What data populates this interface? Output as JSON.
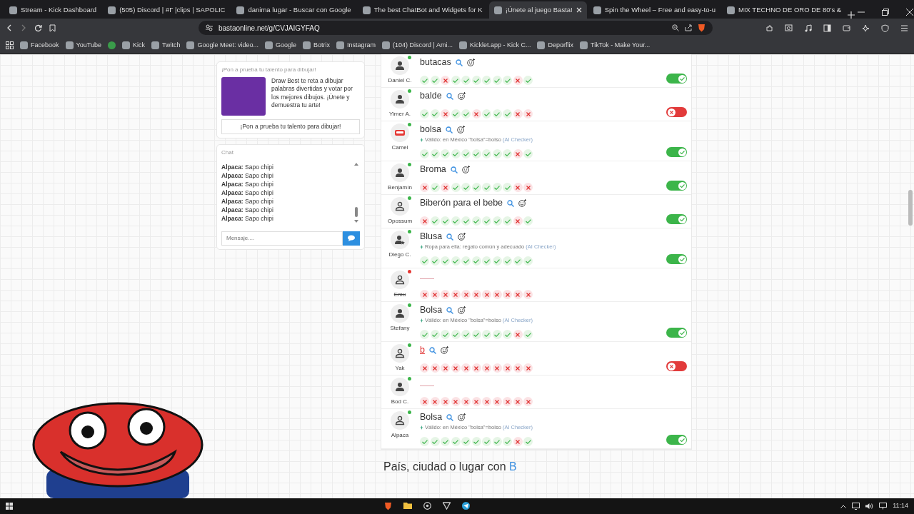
{
  "browser": {
    "tabs": [
      {
        "title": "Stream - Kick Dashboard",
        "selected": false
      },
      {
        "title": "(505) Discord | #Γ |clips | SAPOLIC",
        "selected": false
      },
      {
        "title": "danima lugar - Buscar con Google",
        "selected": false
      },
      {
        "title": "The best ChatBot and Widgets for K",
        "selected": false
      },
      {
        "title": "¡Únete al juego Basta!",
        "selected": true
      },
      {
        "title": "Spin the Wheel – Free and easy-to-u",
        "selected": false
      },
      {
        "title": "MIX TECHNO DE ORO DE 80's &",
        "selected": false
      }
    ],
    "url": "bastaonline.net/g/CVJAIGYFAQ",
    "bookmarks": [
      {
        "kind": "link",
        "label": "Facebook"
      },
      {
        "kind": "link",
        "label": "YouTube"
      },
      {
        "kind": "icon"
      },
      {
        "kind": "link",
        "label": "Kick"
      },
      {
        "kind": "link",
        "label": "Twitch"
      },
      {
        "kind": "link",
        "label": "Google Meet: video..."
      },
      {
        "kind": "link",
        "label": "Google"
      },
      {
        "kind": "link",
        "label": "Botrix"
      },
      {
        "kind": "link",
        "label": "Instagram"
      },
      {
        "kind": "link",
        "label": "(104) Discord | Ami..."
      },
      {
        "kind": "link",
        "label": "Kicklet.app - Kick C..."
      },
      {
        "kind": "link",
        "label": "Deporflix"
      },
      {
        "kind": "link",
        "label": "TikTok - Make Your..."
      }
    ]
  },
  "promo": {
    "heading": "¡Pon a prueba tu talento para dibujar!",
    "text": "Draw Best te reta a dibujar palabras divertidas y votar por los mejores dibujos. ¡Únete y demuestra tu arte!",
    "button": "¡Pon a prueba tu talento para dibujar!"
  },
  "chat": {
    "title": "Chat",
    "messages": [
      "**Alpaca:** Sapo chipi",
      "**Alpaca:** Sapo chipi",
      "**Alpaca:** Sapo chipi",
      "**Alpaca:** Sapo chipi",
      "**Alpaca:** Sapo chipi",
      "**Alpaca:** Sapo chipi",
      "**Alpaca:** Sapo chipi"
    ],
    "placeholder": "Mensaje...."
  },
  "answers": [
    {
      "player": "Daniel C.",
      "avatar": {
        "kind": "person"
      },
      "online": true,
      "kind": "word",
      "answer": "butacas",
      "votes": [
        true,
        true,
        false,
        true,
        true,
        true,
        true,
        true,
        true,
        false,
        true
      ],
      "toggle": {
        "on": true
      }
    },
    {
      "player": "Yimer A.",
      "avatar": {
        "kind": "person"
      },
      "online": true,
      "kind": "word",
      "answer": "balde",
      "votes": [
        true,
        true,
        false,
        true,
        true,
        false,
        true,
        true,
        true,
        false,
        false
      ],
      "toggle": {
        "on": false
      }
    },
    {
      "player": "Camel",
      "avatar": {
        "kind": "stop"
      },
      "online": true,
      "kind": "word",
      "answer": "bolsa",
      "note": "Válido: en México \"bolsa\"=bolso",
      "note_source": "(AI Checker)",
      "votes": [
        true,
        true,
        true,
        true,
        true,
        true,
        true,
        true,
        true,
        false,
        true
      ],
      "toggle": {
        "on": true
      }
    },
    {
      "player": "Benjamín",
      "avatar": {
        "kind": "person"
      },
      "online": true,
      "kind": "word",
      "answer": "Broma",
      "votes": [
        false,
        true,
        false,
        true,
        true,
        true,
        true,
        true,
        true,
        false,
        false
      ],
      "toggle": {
        "on": true
      }
    },
    {
      "player": "Opossum",
      "avatar": {
        "kind": "outline"
      },
      "online": true,
      "kind": "word",
      "answer": "Biberón para el bebe",
      "votes": [
        false,
        true,
        true,
        true,
        true,
        true,
        true,
        true,
        true,
        false,
        true
      ],
      "toggle": {
        "on": true
      }
    },
    {
      "player": "Diego C.",
      "avatar": {
        "kind": "star"
      },
      "online": true,
      "kind": "word",
      "answer": "Blusa",
      "note": "Ropa para ella: regalo común y adecuado",
      "note_source": "(AI Checker)",
      "votes": [
        true,
        true,
        true,
        true,
        true,
        true,
        true,
        true,
        true,
        true,
        true
      ],
      "toggle": {
        "on": true
      }
    },
    {
      "player": "Emu",
      "avatar": {
        "kind": "outline"
      },
      "online": false,
      "kind": "blank",
      "votes": [
        false,
        false,
        false,
        false,
        false,
        false,
        false,
        false,
        false,
        false,
        false
      ]
    },
    {
      "player": "Stefany",
      "avatar": {
        "kind": "person"
      },
      "online": true,
      "kind": "word",
      "answer": "Bolsa",
      "note": "Válido: en México \"bolsa\"=bolso",
      "note_source": "(AI Checker)",
      "votes": [
        true,
        true,
        true,
        true,
        true,
        true,
        true,
        true,
        true,
        false,
        true
      ],
      "toggle": {
        "on": true
      }
    },
    {
      "player": "Yak",
      "avatar": {
        "kind": "outline"
      },
      "online": true,
      "kind": "invalid",
      "answer": "b",
      "votes": [
        false,
        false,
        false,
        false,
        false,
        false,
        false,
        false,
        false,
        false,
        false
      ],
      "toggle": {
        "on": false
      }
    },
    {
      "player": "Bod C.",
      "avatar": {
        "kind": "person"
      },
      "online": true,
      "kind": "blank",
      "votes": [
        false,
        false,
        false,
        false,
        false,
        false,
        false,
        false,
        false,
        false,
        false
      ]
    },
    {
      "player": "Alpaca",
      "avatar": {
        "kind": "outline"
      },
      "online": true,
      "kind": "word",
      "answer": "Bolsa",
      "note": "Válido: en México \"bolsa\"=bolso",
      "note_source": "(AI Checker)",
      "votes": [
        true,
        true,
        true,
        true,
        true,
        true,
        true,
        true,
        true,
        false,
        true
      ],
      "toggle": {
        "on": true
      }
    }
  ],
  "next_category": {
    "text": "País, ciudad o lugar con ",
    "letter": "B"
  },
  "taskbar": {
    "time": "11:14"
  }
}
